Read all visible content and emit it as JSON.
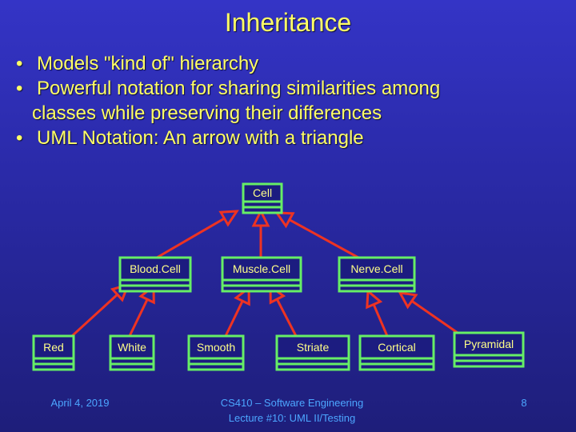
{
  "slide": {
    "title": "Inheritance",
    "bullets": [
      {
        "text": "Models \"kind of\" hierarchy"
      },
      {
        "text": "Powerful notation for sharing similarities among",
        "continuation": "classes while preserving their differences"
      },
      {
        "text": "UML Notation: An arrow with a triangle"
      }
    ],
    "bullet_glyph": "•"
  },
  "diagram": {
    "colors": {
      "box_border": "#66ee66",
      "box_fill": "#1c1c80",
      "arrow": "#ee3322",
      "label": "#ffff88"
    },
    "classes": [
      {
        "id": "cell",
        "name": "Cell"
      },
      {
        "id": "bloodcell",
        "name": "Blood.Cell"
      },
      {
        "id": "musclecell",
        "name": "Muscle.Cell"
      },
      {
        "id": "nervecell",
        "name": "Nerve.Cell"
      },
      {
        "id": "red",
        "name": "Red"
      },
      {
        "id": "white",
        "name": "White"
      },
      {
        "id": "smooth",
        "name": "Smooth"
      },
      {
        "id": "striate",
        "name": "Striate"
      },
      {
        "id": "cortical",
        "name": "Cortical"
      },
      {
        "id": "pyramidal",
        "name": "Pyramidal"
      }
    ],
    "inheritance": [
      {
        "child": "bloodcell",
        "parent": "cell"
      },
      {
        "child": "musclecell",
        "parent": "cell"
      },
      {
        "child": "nervecell",
        "parent": "cell"
      },
      {
        "child": "red",
        "parent": "bloodcell"
      },
      {
        "child": "white",
        "parent": "bloodcell"
      },
      {
        "child": "smooth",
        "parent": "musclecell"
      },
      {
        "child": "striate",
        "parent": "musclecell"
      },
      {
        "child": "cortical",
        "parent": "nervecell"
      },
      {
        "child": "pyramidal",
        "parent": "nervecell"
      }
    ]
  },
  "footer": {
    "date": "April 4, 2019",
    "course": "CS410 – Software Engineering",
    "lecture": "Lecture #10: UML II/Testing",
    "page_number": "8"
  }
}
